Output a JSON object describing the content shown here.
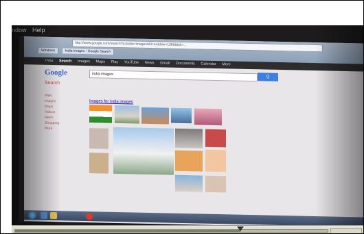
{
  "menu": {
    "items": [
      "ndow",
      "Help"
    ]
  },
  "browser": {
    "tab_1": "Windows",
    "tab_2": "India Images - Google Search",
    "url": "http://www.google.com/search?q=india+images&hl=en&biw=1366&bih=...",
    "gbar_items": [
      "+You",
      "Search",
      "Images",
      "Maps",
      "Play",
      "YouTube",
      "News",
      "Gmail",
      "Documents",
      "Calendar",
      "More"
    ],
    "logo": "Google",
    "query": "india images",
    "search_button": "Q",
    "side_label": "Search",
    "sidebar_items": [
      "Web",
      "Images",
      "Maps",
      "Videos",
      "News",
      "Shopping",
      "More"
    ],
    "result_title": "Images for india images"
  },
  "player": {
    "progress": 0.72
  }
}
